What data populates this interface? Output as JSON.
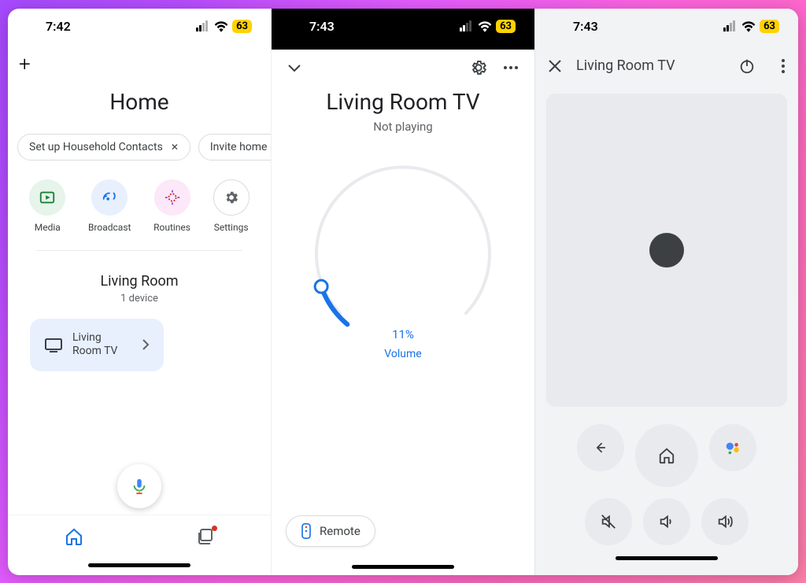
{
  "status": {
    "time_a": "7:42",
    "time_b": "7:43",
    "time_c": "7:43",
    "battery": "63"
  },
  "phone_a": {
    "home_title": "Home",
    "chips": {
      "setup_contacts": "Set up Household Contacts",
      "invite": "Invite home mem"
    },
    "quick": {
      "media": "Media",
      "broadcast": "Broadcast",
      "routines": "Routines",
      "settings": "Settings"
    },
    "room": {
      "name": "Living Room",
      "sub": "1 device"
    },
    "device": {
      "name": "Living Room TV"
    }
  },
  "phone_b": {
    "device_title": "Living Room TV",
    "status": "Not playing",
    "volume_pct": "11%",
    "volume_label": "Volume",
    "remote_label": "Remote",
    "dial_percent": 11
  },
  "phone_c": {
    "title": "Living Room TV"
  }
}
